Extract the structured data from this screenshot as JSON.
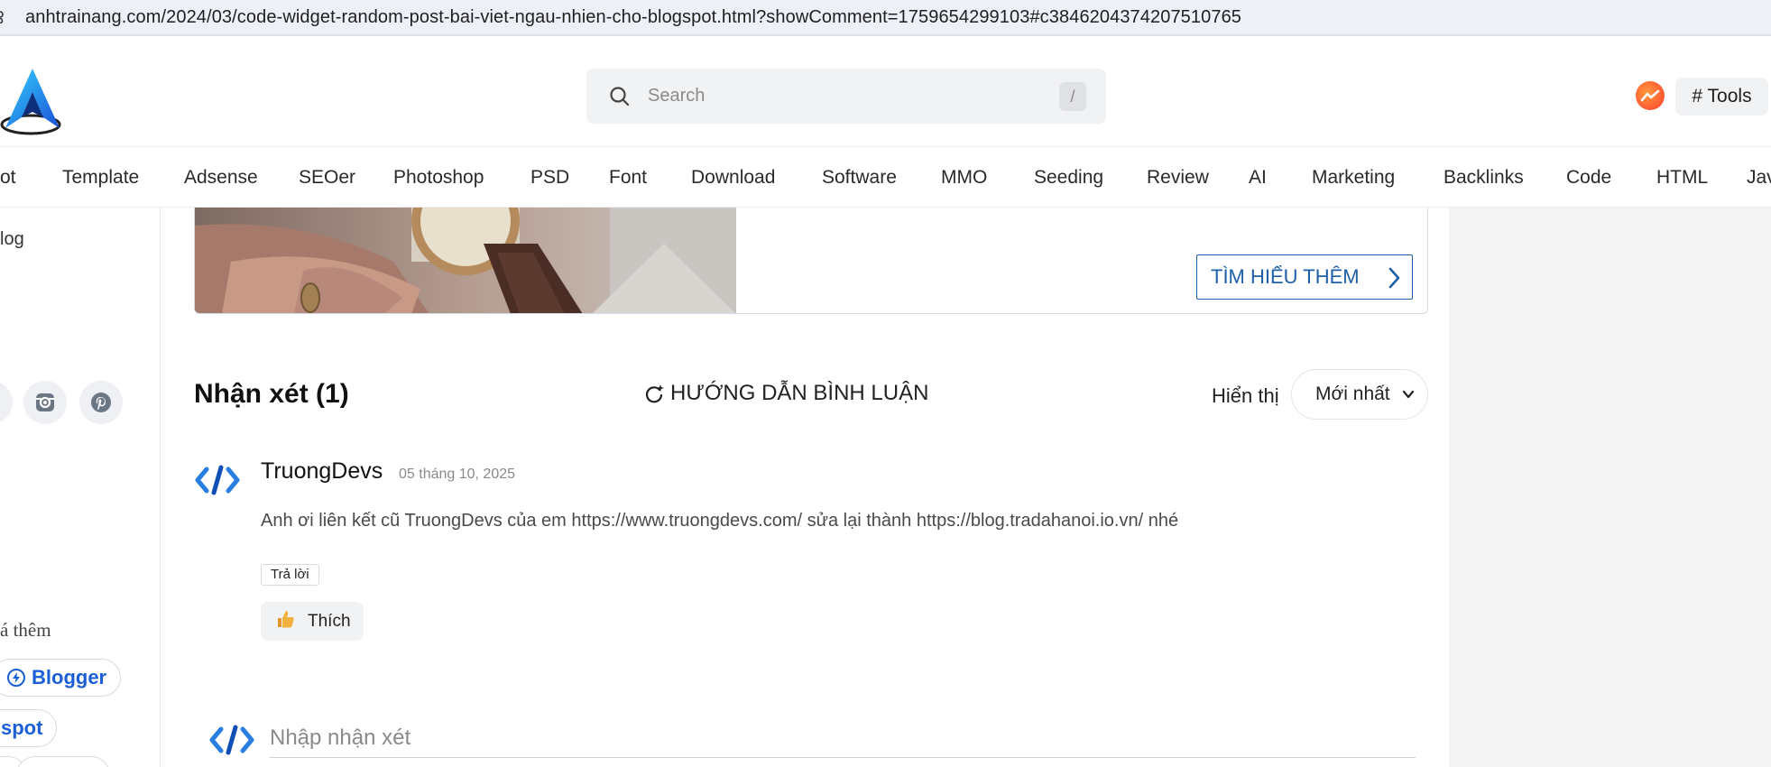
{
  "browser": {
    "url": "anhtrainang.com/2024/03/code-widget-random-post-bai-viet-ngau-nhien-cho-blogspot.html?showComment=1759654299103#c3846204374207510765"
  },
  "header": {
    "search_placeholder": "Search",
    "search_shortcut": "/",
    "tools_label": "# Tools"
  },
  "nav": {
    "items": [
      "ot",
      "Template",
      "Adsense",
      "SEOer",
      "Photoshop",
      "PSD",
      "Font",
      "Download",
      "Software",
      "MMO",
      "Seeding",
      "Review",
      "AI",
      "Marketing",
      "Backlinks",
      "Code",
      "HTML",
      "Jav"
    ]
  },
  "sidebar": {
    "partial_label_top": "log",
    "partial_label_more": "á thêm",
    "tags": [
      "Blogger",
      "spot"
    ]
  },
  "ad": {
    "cta_label": "TÌM HIỂU THÊM"
  },
  "comments": {
    "title": "Nhận xét (1)",
    "guide_label": "HƯỚNG DẪN BÌNH LUẬN",
    "show_label": "Hiển thị",
    "sort_value": "Mới nhất",
    "items": [
      {
        "author": "TruongDevs",
        "date": "05 tháng 10, 2025",
        "text": "Anh ơi liên kết cũ TruongDevs của em https://www.truongdevs.com/ sửa lại thành https://blog.tradahanoi.io.vn/ nhé",
        "reply_label": "Trả lời",
        "like_label": "Thích"
      }
    ],
    "input_placeholder": "Nhập nhận xét"
  },
  "colors": {
    "accent_blue": "#1d5fa8",
    "tag_blue": "#1a5fd6",
    "right_column_bg": "#f5f5f6"
  }
}
